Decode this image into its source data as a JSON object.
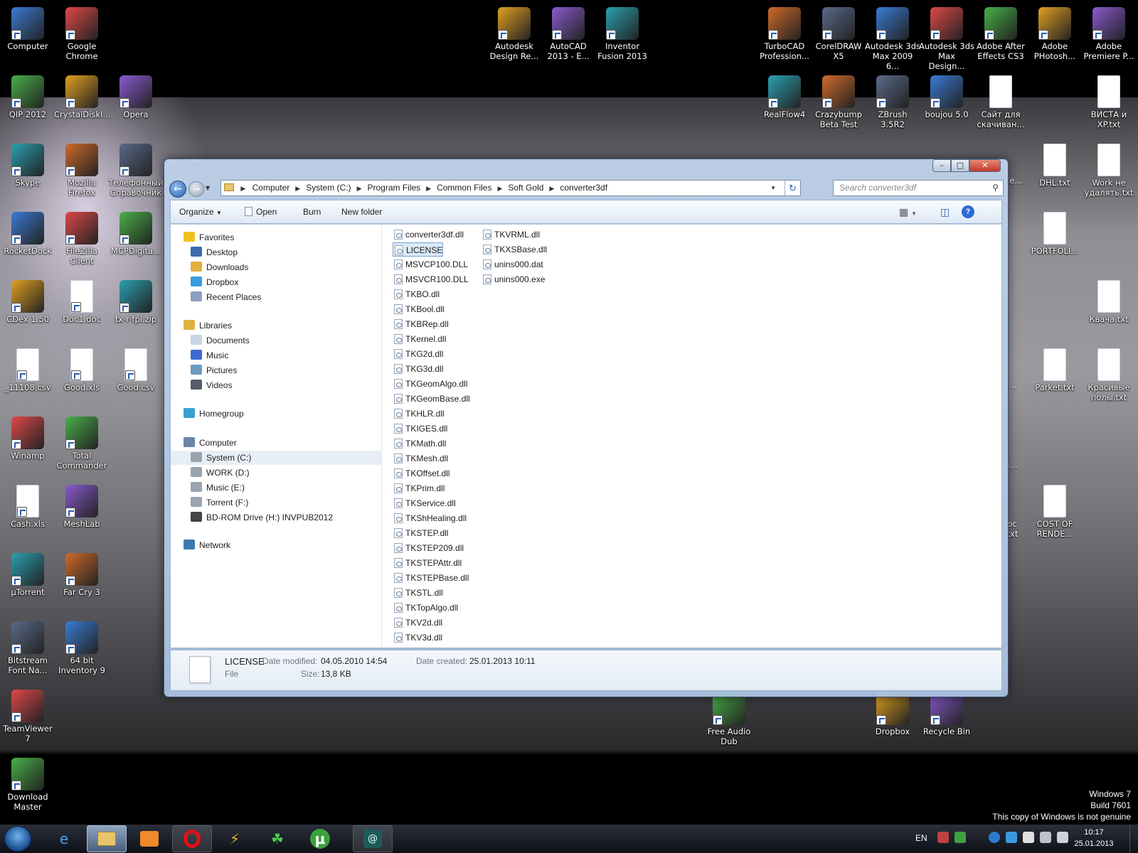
{
  "desktop": {
    "icons_left": [
      {
        "label": "Computer"
      },
      {
        "label": "Google\nChrome"
      },
      {
        "label": "QIP 2012"
      },
      {
        "label": "CrystalDiskI..."
      },
      {
        "label": "Opera"
      },
      {
        "label": "Skype"
      },
      {
        "label": "Mozilla\nFirefox"
      },
      {
        "label": "Телефонный\nСправочник"
      },
      {
        "label": "RocketDock"
      },
      {
        "label": "FileZilla\nClient"
      },
      {
        "label": "MCPDigita..."
      },
      {
        "label": "CDex 1.50"
      },
      {
        "label": "Doc1.doc"
      },
      {
        "label": "tx-r-fpl.zip"
      },
      {
        "label": "_11108.csv"
      },
      {
        "label": "Good.xls"
      },
      {
        "label": "Good.csv"
      },
      {
        "label": "Winamp"
      },
      {
        "label": "Total\nCommander"
      },
      {
        "label": "Cash.xls"
      },
      {
        "label": "MeshLab"
      },
      {
        "label": "µTorrent"
      },
      {
        "label": "Far Cry 3"
      },
      {
        "label": "Bitstream\nFont Na..."
      },
      {
        "label": "64 bit\nInventory 9"
      },
      {
        "label": "TeamViewer\n7"
      },
      {
        "label": "Download\nMaster"
      }
    ],
    "icons_top": [
      {
        "label": "Autodesk\nDesign Re..."
      },
      {
        "label": "AutoCAD\n2013 - E..."
      },
      {
        "label": "Inventor\nFusion 2013"
      },
      {
        "label": "TurboCAD\nProfession..."
      },
      {
        "label": "CorelDRAW\nX5"
      },
      {
        "label": "Autodesk 3ds\nMax 2009 6..."
      },
      {
        "label": "Autodesk 3ds\nMax Design..."
      },
      {
        "label": "Adobe After\nEffects CS3"
      },
      {
        "label": "Adobe\nPHotosh..."
      },
      {
        "label": "Adobe\nPremiere P..."
      }
    ],
    "icons_right": [
      {
        "label": "RealFlow4"
      },
      {
        "label": "Crazybump\nBeta Test"
      },
      {
        "label": "ZBrush 3.5R2"
      },
      {
        "label": "boujou 5.0"
      },
      {
        "label": "Сайт для\nскачиван..."
      },
      {
        "label": "ВИСТА и\nXP.txt"
      },
      {
        "label": "DHL.txt"
      },
      {
        "label": "Work не\nудалять.txt"
      },
      {
        "label": "PORTFOLI..."
      },
      {
        "label": "Квача.txt"
      },
      {
        "label": "Parket.txt"
      },
      {
        "label": "Красивые\nполы.txt"
      },
      {
        "label": "COST OF\nRENDE..."
      },
      {
        "label": "Free Audio\nDub"
      },
      {
        "label": "Dropbox"
      },
      {
        "label": "Recycle Bin"
      }
    ],
    "partial_labels": [
      "de...",
      "o...",
      "н...",
      "roc\n.txt"
    ]
  },
  "window": {
    "breadcrumb": [
      "Computer",
      "System (C:)",
      "Program Files",
      "Common Files",
      "Soft Gold",
      "converter3df"
    ],
    "search_placeholder": "Search converter3df",
    "toolbar": {
      "organize": "Organize",
      "open": "Open",
      "burn": "Burn",
      "new_folder": "New folder"
    },
    "nav": {
      "favorites": "Favorites",
      "favorites_items": [
        "Desktop",
        "Downloads",
        "Dropbox",
        "Recent Places"
      ],
      "libraries": "Libraries",
      "libraries_items": [
        "Documents",
        "Music",
        "Pictures",
        "Videos"
      ],
      "homegroup": "Homegroup",
      "computer": "Computer",
      "computer_items": [
        "System (C:)",
        "WORK (D:)",
        "Music (E:)",
        "Torrent (F:)",
        "BD-ROM Drive (H:) INVPUB2012"
      ],
      "network": "Network"
    },
    "files_col1": [
      "converter3df.dll",
      "LICENSE",
      "MSVCP100.DLL",
      "MSVCR100.DLL",
      "TKBO.dll",
      "TKBool.dll",
      "TKBRep.dll",
      "TKernel.dll",
      "TKG2d.dll",
      "TKG3d.dll",
      "TKGeomAlgo.dll",
      "TKGeomBase.dll",
      "TKHLR.dll",
      "TKIGES.dll",
      "TKMath.dll",
      "TKMesh.dll",
      "TKOffset.dll",
      "TKPrim.dll",
      "TKService.dll",
      "TKShHealing.dll",
      "TKSTEP.dll",
      "TKSTEP209.dll",
      "TKSTEPAttr.dll",
      "TKSTEPBase.dll",
      "TKSTL.dll",
      "TKTopAlgo.dll",
      "TKV2d.dll",
      "TKV3d.dll"
    ],
    "files_col2": [
      "TKVRML.dll",
      "TKXSBase.dll",
      "unins000.dat",
      "unins000.exe"
    ],
    "selected_file": "LICENSE",
    "details": {
      "name": "LICENSE",
      "type": "File",
      "modified_label": "Date modified:",
      "modified": "04.05.2010 14:54",
      "size_label": "Size:",
      "size": "13,8 KB",
      "created_label": "Date created:",
      "created": "25.01.2013 10:11"
    }
  },
  "watermark": [
    "Windows 7",
    "Build 7601",
    "This copy of Windows is not genuine"
  ],
  "taskbar": {
    "lang": "EN",
    "time": "10:17",
    "date": "25.01.2013"
  },
  "colors": {
    "accent": "#2a5db0",
    "selection": "#dbe9f8"
  }
}
